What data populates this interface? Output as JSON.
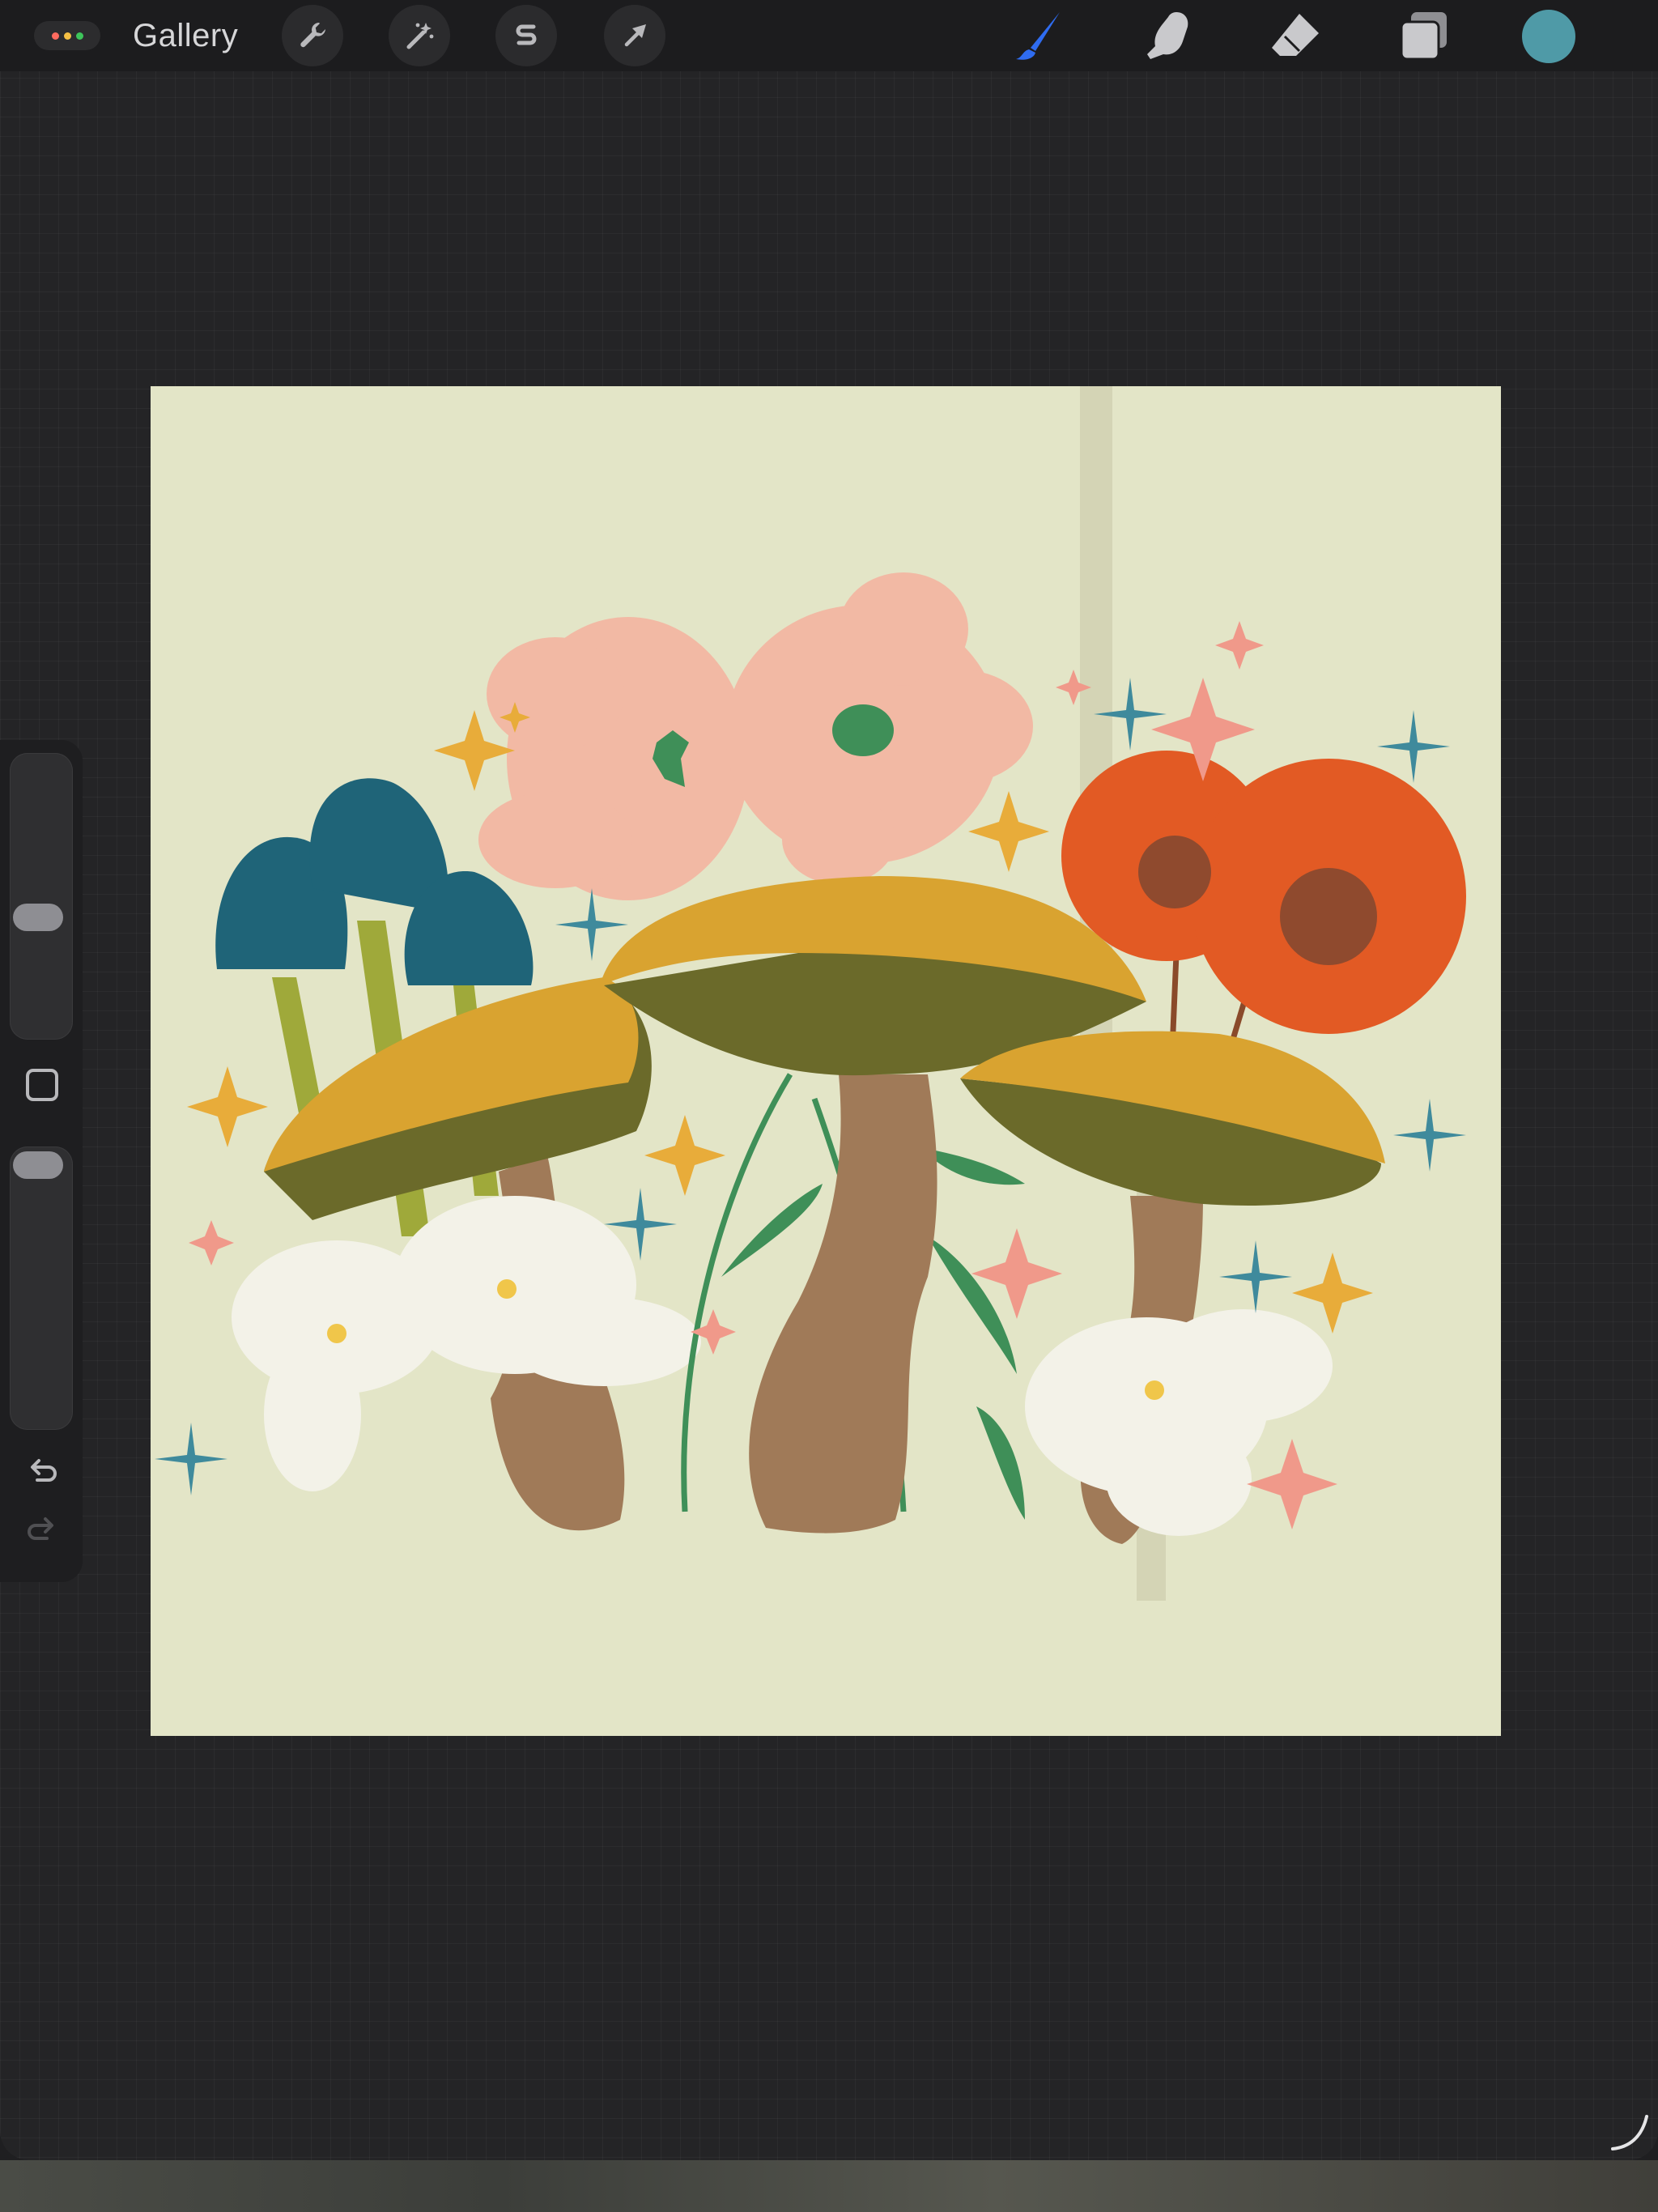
{
  "topbar": {
    "gallery_label": "Gallery",
    "menu_dot_colors": [
      "#ff6b5f",
      "#f5c044",
      "#3dc45a"
    ],
    "left_tools": [
      {
        "name": "actions",
        "icon": "wrench-icon"
      },
      {
        "name": "adjustments",
        "icon": "magic-wand-icon"
      },
      {
        "name": "selection",
        "icon": "selection-s-icon"
      },
      {
        "name": "transform",
        "icon": "arrow-cursor-icon"
      }
    ],
    "right_tools": [
      {
        "name": "brush",
        "icon": "paintbrush-icon",
        "active": true
      },
      {
        "name": "smudge",
        "icon": "smudge-finger-icon",
        "active": false
      },
      {
        "name": "eraser",
        "icon": "eraser-icon",
        "active": false
      },
      {
        "name": "layers",
        "icon": "layers-icon",
        "active": false
      }
    ],
    "current_color": "#4f9aa7",
    "active_tool_color": "#2f6cf0"
  },
  "sidebar": {
    "brush_size_icon": "brush-size-slider",
    "brush_opacity_icon": "brush-opacity-slider",
    "modify_icon": "square-modify-icon",
    "undo_icon": "undo-icon",
    "redo_icon": "redo-icon",
    "redo_enabled": false
  },
  "canvas": {
    "background_color": "#e3e5c7",
    "artwork_icon": "mushroom-flower-illustration",
    "palette": {
      "teal_mushroom": "#1f6478",
      "golden_cap": "#d9a330",
      "olive_gill": "#6b6a2a",
      "stem_brown": "#a07a58",
      "pink_flower": "#f2b9a4",
      "orange_flower": "#e25a24",
      "white_flower": "#f3f2e8",
      "leaf_green": "#3f8f58",
      "sparkle_gold": "#e8ac3a",
      "sparkle_pink": "#f0998a",
      "sparkle_blue": "#3f8a9c"
    }
  }
}
